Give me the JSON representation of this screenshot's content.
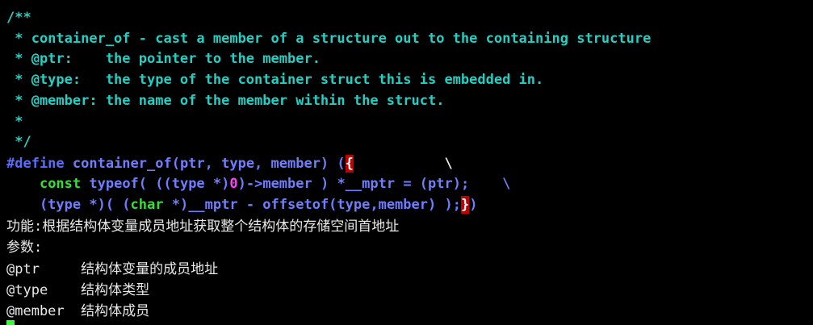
{
  "comment": {
    "open": "/**",
    "l1": " * container_of - cast a member of a structure out to the containing structure",
    "l2": " * @ptr:    the pointer to the member.",
    "l3": " * @type:   the type of the container struct this is embedded in.",
    "l4": " * @member: the name of the member within the struct.",
    "l5": " *",
    "close": " */"
  },
  "macro": {
    "define_kw": "#define",
    "signature": " container_of(ptr, type, member) (",
    "brace_open": "{",
    "cont1": "           \\",
    "indent": "    ",
    "const_kw": "const",
    "l2a": " typeof( ((type *)",
    "zero": "0",
    "l2b": ")->member ) *__mptr = (ptr);    \\",
    "l3a": "    (type *)( (",
    "char_kw": "char",
    "l3b": " *)__mptr - offsetof(type,member) );",
    "brace_close": "}",
    "l3c": ")"
  },
  "notes": {
    "function": "功能:根据结构体变量成员地址获取整个结构体的存储空间首地址",
    "params_label": "参数:",
    "p1": "@ptr     结构体变量的成员地址",
    "p2": "@type    结构体类型",
    "p3": "@member  结构体成员"
  },
  "colors": {
    "comment": "#21d0c4",
    "preprocessor": "#5a6cff",
    "keyword": "#35e035",
    "number": "#ff40ff",
    "brace_highlight": "#c00000",
    "cursor": "#33ff33"
  }
}
